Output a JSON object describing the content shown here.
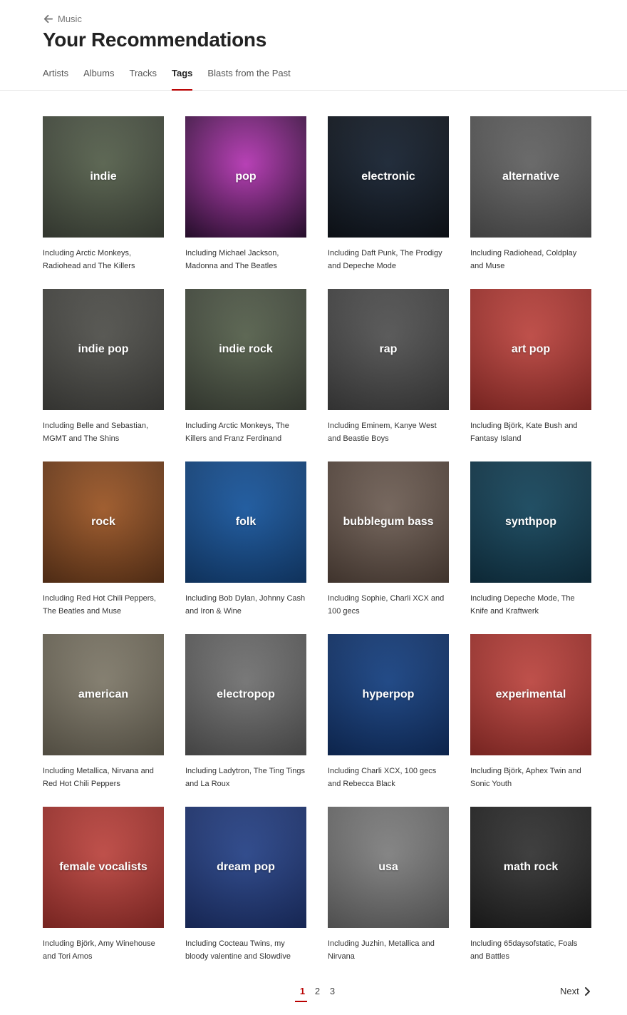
{
  "back": {
    "label": "Music",
    "icon": "arrow-left-icon"
  },
  "page_title": "Your Recommendations",
  "tabs": [
    {
      "label": "Artists",
      "active": false
    },
    {
      "label": "Albums",
      "active": false
    },
    {
      "label": "Tracks",
      "active": false
    },
    {
      "label": "Tags",
      "active": true
    },
    {
      "label": "Blasts from the Past",
      "active": false
    }
  ],
  "accent_color": "#b90000",
  "tags": [
    {
      "name": "indie",
      "desc": "Including Arctic Monkeys, Radiohead and The Killers",
      "tint": "#5f6a55",
      "art": "#3a3f36"
    },
    {
      "name": "pop",
      "desc": "Including Michael Jackson, Madonna and The Beatles",
      "tint": "#c13fbf",
      "art": "#2a1030"
    },
    {
      "name": "electronic",
      "desc": "Including Daft Punk, The Prodigy and Depeche Mode",
      "tint": "#1e2a3a",
      "art": "#0e1218"
    },
    {
      "name": "alternative",
      "desc": "Including Radiohead, Coldplay and Muse",
      "tint": "#6d6d6d",
      "art": "#4a4a4a"
    },
    {
      "name": "indie pop",
      "desc": "Including Belle and Sebastian, MGMT and The Shins",
      "tint": "#5a5a55",
      "art": "#3c3c39"
    },
    {
      "name": "indie rock",
      "desc": "Including Arctic Monkeys, The Killers and Franz Ferdinand",
      "tint": "#5f6a55",
      "art": "#3a3f36"
    },
    {
      "name": "rap",
      "desc": "Including Eminem, Kanye West and Beastie Boys",
      "tint": "#5c5c5c",
      "art": "#3a3a3a"
    },
    {
      "name": "art pop",
      "desc": "Including Björk, Kate Bush and Fantasy Island",
      "tint": "#c9504a",
      "art": "#8a2a26"
    },
    {
      "name": "rock",
      "desc": "Including Red Hot Chili Peppers, The Beatles and Muse",
      "tint": "#a8602e",
      "art": "#5a3218"
    },
    {
      "name": "folk",
      "desc": "Including Bob Dylan, Johnny Cash and Iron & Wine",
      "tint": "#1f5fa8",
      "art": "#123a6a"
    },
    {
      "name": "bubblegum bass",
      "desc": "Including Sophie, Charli XCX and 100 gecs",
      "tint": "#7a6a60",
      "art": "#4a3c34"
    },
    {
      "name": "synthpop",
      "desc": "Including Depeche Mode, The Knife and Kraftwerk",
      "tint": "#1d4f66",
      "art": "#0f2e3e"
    },
    {
      "name": "american",
      "desc": "Including Metallica, Nirvana and Red Hot Chili Peppers",
      "tint": "#8a8474",
      "art": "#5e594c"
    },
    {
      "name": "electropop",
      "desc": "Including Ladytron, The Ting Tings and La Roux",
      "tint": "#7c7c7c",
      "art": "#4e4e4e"
    },
    {
      "name": "hyperpop",
      "desc": "Including Charli XCX, 100 gecs and Rebecca Black",
      "tint": "#1e4a8c",
      "art": "#0f2a58"
    },
    {
      "name": "experimental",
      "desc": "Including Björk, Aphex Twin and Sonic Youth",
      "tint": "#c9504a",
      "art": "#8a2a26"
    },
    {
      "name": "female vocalists",
      "desc": "Including Björk, Amy Winehouse and Tori Amos",
      "tint": "#c9504a",
      "art": "#8a2a26"
    },
    {
      "name": "dream pop",
      "desc": "Including Cocteau Twins, my bloody valentine and Slowdive",
      "tint": "#2f4c92",
      "art": "#1a2c60"
    },
    {
      "name": "usa",
      "desc": "Including Juzhin, Metallica and Nirvana",
      "tint": "#8a8a8a",
      "art": "#5c5c5c"
    },
    {
      "name": "math rock",
      "desc": "Including 65daysofstatic, Foals and Battles",
      "tint": "#3e3e3e",
      "art": "#1c1c1c"
    }
  ],
  "pagination": {
    "pages": [
      "1",
      "2",
      "3"
    ],
    "active": "1",
    "next_label": "Next",
    "next_icon": "chevron-right-icon"
  }
}
